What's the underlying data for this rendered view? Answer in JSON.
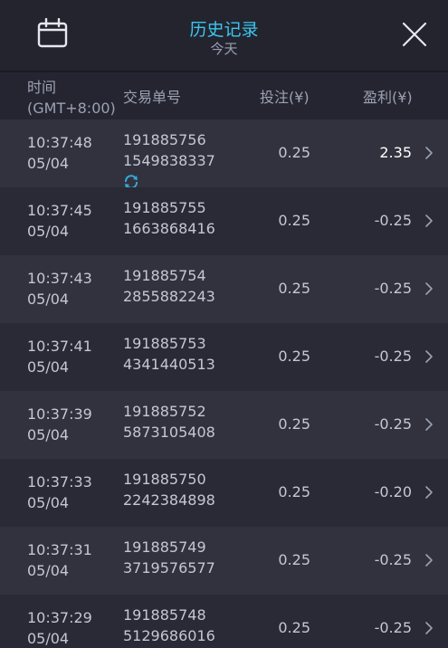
{
  "header": {
    "title": "历史记录",
    "subtitle": "今天"
  },
  "columns": {
    "time_line1": "时间",
    "time_line2": "(GMT+8:00)",
    "order_id": "交易单号",
    "stake": "投注(¥)",
    "profit": "盈利(¥)"
  },
  "icons": {
    "calendar": "calendar-icon",
    "close": "close-icon",
    "chevron": "chevron-right-icon",
    "loading": "loading-spinner-icon"
  },
  "colors": {
    "title": "#3cc6f0",
    "accent": "#2b88d8",
    "spinner": "#3aa6d8"
  },
  "rows": [
    {
      "time": "10:37:48",
      "date": "05/04",
      "id_line1": "191885756",
      "id_line2": "1549838337",
      "stake": "0.25",
      "profit": "2.35",
      "win": true,
      "pending": true
    },
    {
      "time": "10:37:45",
      "date": "05/04",
      "id_line1": "191885755",
      "id_line2": "1663868416",
      "stake": "0.25",
      "profit": "-0.25",
      "win": false,
      "pending": false
    },
    {
      "time": "10:37:43",
      "date": "05/04",
      "id_line1": "191885754",
      "id_line2": "2855882243",
      "stake": "0.25",
      "profit": "-0.25",
      "win": false,
      "pending": false
    },
    {
      "time": "10:37:41",
      "date": "05/04",
      "id_line1": "191885753",
      "id_line2": "4341440513",
      "stake": "0.25",
      "profit": "-0.25",
      "win": false,
      "pending": false
    },
    {
      "time": "10:37:39",
      "date": "05/04",
      "id_line1": "191885752",
      "id_line2": "5873105408",
      "stake": "0.25",
      "profit": "-0.25",
      "win": false,
      "pending": false
    },
    {
      "time": "10:37:33",
      "date": "05/04",
      "id_line1": "191885750",
      "id_line2": "2242384898",
      "stake": "0.25",
      "profit": "-0.20",
      "win": false,
      "pending": false
    },
    {
      "time": "10:37:31",
      "date": "05/04",
      "id_line1": "191885749",
      "id_line2": "3719576577",
      "stake": "0.25",
      "profit": "-0.25",
      "win": false,
      "pending": false
    },
    {
      "time": "10:37:29",
      "date": "05/04",
      "id_line1": "191885748",
      "id_line2": "5129686016",
      "stake": "0.25",
      "profit": "-0.25",
      "win": false,
      "pending": false
    }
  ]
}
